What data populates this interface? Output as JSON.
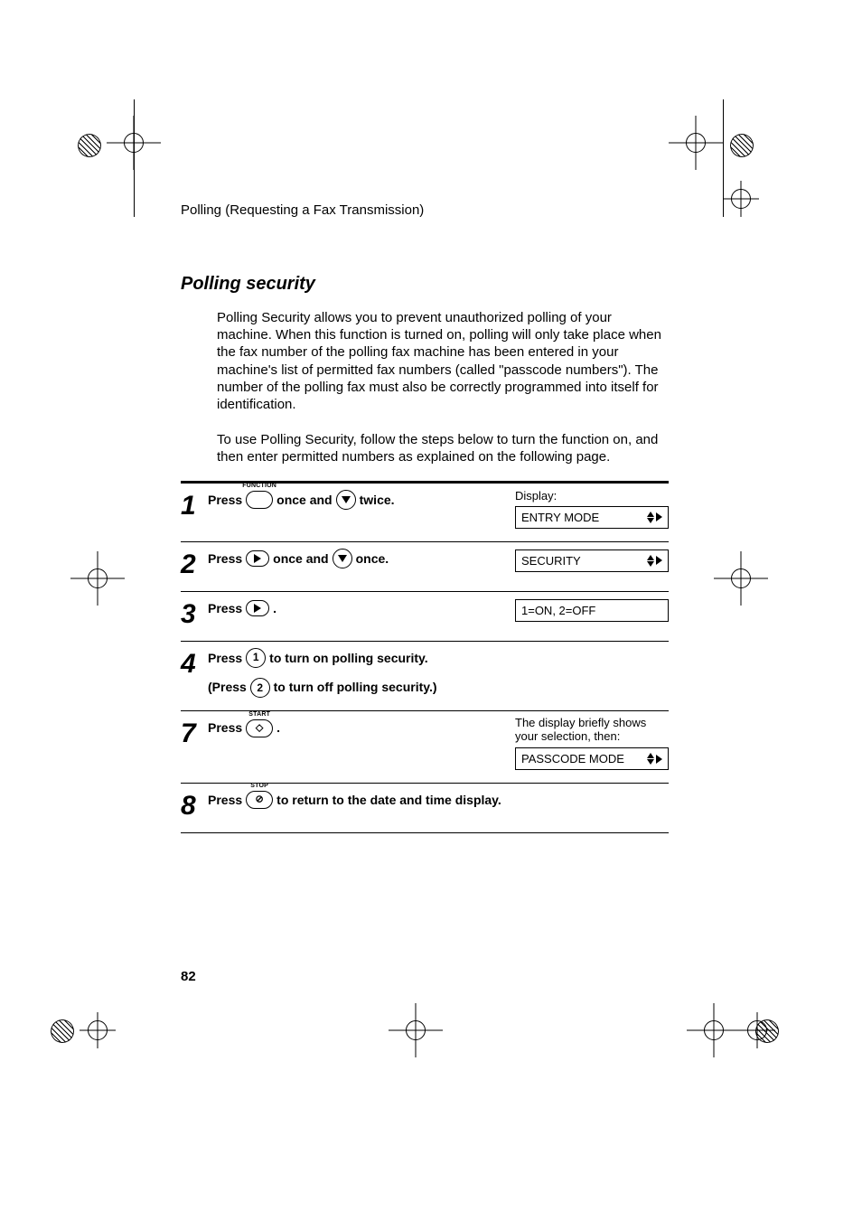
{
  "page": {
    "running_head": "Polling (Requesting a Fax Transmission)",
    "section_title": "Polling security",
    "para1": "Polling Security allows you to prevent unauthorized polling of your machine. When this function is turned on, polling will only take place when the fax number of the polling fax machine has been entered in your machine's list of permitted fax numbers (called \"passcode numbers\"). The number of the polling fax must also be correctly programmed into itself for identification.",
    "para2": "To use Polling Security, follow the steps below to turn the function on, and then enter permitted numbers as explained on the following page.",
    "page_number": "82"
  },
  "labels": {
    "display": "Display:",
    "press": "Press",
    "press_paren": "(Press",
    "once_and": "once and",
    "twice": "twice.",
    "once": "once.",
    "period": ".",
    "key_function": "FUNCTION",
    "key_start": "START",
    "key_stop": "STOP",
    "step4_on": "to turn on polling security.",
    "step4_off": "to turn off polling security.)",
    "step7_note": "The display briefly shows your selection, then:",
    "step8_tail": "to return to the date and time display."
  },
  "lcd": {
    "s1": "ENTRY MODE",
    "s2": "SECURITY",
    "s3": "1=ON, 2=OFF",
    "s7": "PASSCODE MODE"
  },
  "steps": {
    "n1": "1",
    "n2": "2",
    "n3": "3",
    "n4": "4",
    "n7": "7",
    "n8": "8",
    "k1": "1",
    "k2": "2"
  }
}
